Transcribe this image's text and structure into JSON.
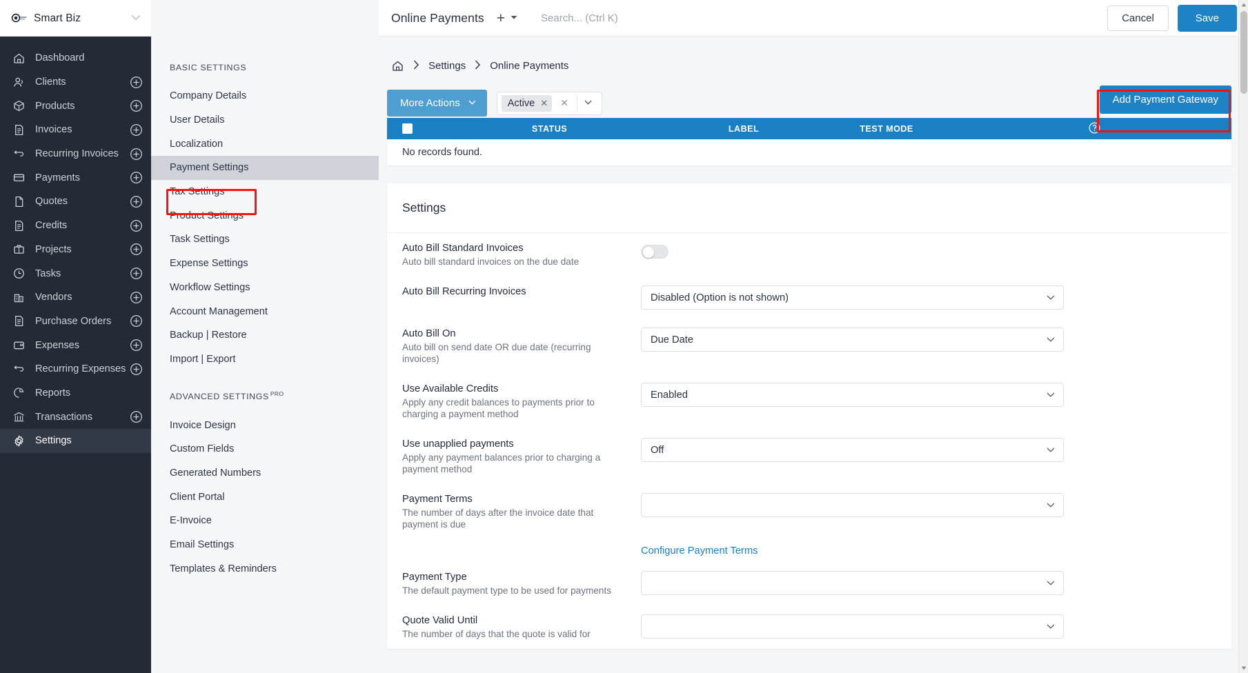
{
  "brand": {
    "name": "Smart Biz",
    "subtitle_redacted": true,
    "logo_icon": "invoiceninja-logo-icon",
    "caret_icon": "chevron-down-icon"
  },
  "sidebar": {
    "items": [
      {
        "label": "Dashboard",
        "icon": "home-icon",
        "plus": false,
        "active": false
      },
      {
        "label": "Clients",
        "icon": "users-icon",
        "plus": true,
        "active": false
      },
      {
        "label": "Products",
        "icon": "cube-icon",
        "plus": true,
        "active": false
      },
      {
        "label": "Invoices",
        "icon": "file-text-icon",
        "plus": true,
        "active": false
      },
      {
        "label": "Recurring Invoices",
        "icon": "refresh-icon",
        "plus": true,
        "active": false
      },
      {
        "label": "Payments",
        "icon": "credit-card-icon",
        "plus": true,
        "active": false
      },
      {
        "label": "Quotes",
        "icon": "file-icon",
        "plus": true,
        "active": false
      },
      {
        "label": "Credits",
        "icon": "file-text-icon",
        "plus": true,
        "active": false
      },
      {
        "label": "Projects",
        "icon": "briefcase-icon",
        "plus": true,
        "active": false
      },
      {
        "label": "Tasks",
        "icon": "clock-icon",
        "plus": true,
        "active": false
      },
      {
        "label": "Vendors",
        "icon": "building-icon",
        "plus": true,
        "active": false
      },
      {
        "label": "Purchase Orders",
        "icon": "file-text-icon",
        "plus": true,
        "active": false
      },
      {
        "label": "Expenses",
        "icon": "wallet-icon",
        "plus": true,
        "active": false
      },
      {
        "label": "Recurring Expenses",
        "icon": "refresh-icon",
        "plus": true,
        "active": false
      },
      {
        "label": "Reports",
        "icon": "pie-chart-icon",
        "plus": false,
        "active": false
      },
      {
        "label": "Transactions",
        "icon": "bank-icon",
        "plus": true,
        "active": false
      },
      {
        "label": "Settings",
        "icon": "gear-icon",
        "plus": false,
        "active": true
      }
    ]
  },
  "settings_nav": {
    "basic_title": "BASIC SETTINGS",
    "advanced_title": "ADVANCED SETTINGS",
    "advanced_badge": "PRO",
    "basic_items": [
      {
        "label": "Company Details",
        "selected": false
      },
      {
        "label": "User Details",
        "selected": false
      },
      {
        "label": "Localization",
        "selected": false
      },
      {
        "label": "Payment Settings",
        "selected": true
      },
      {
        "label": "Tax Settings",
        "selected": false
      },
      {
        "label": "Product Settings",
        "selected": false
      },
      {
        "label": "Task Settings",
        "selected": false
      },
      {
        "label": "Expense Settings",
        "selected": false
      },
      {
        "label": "Workflow Settings",
        "selected": false
      },
      {
        "label": "Account Management",
        "selected": false
      },
      {
        "label": "Backup | Restore",
        "selected": false
      },
      {
        "label": "Import | Export",
        "selected": false
      }
    ],
    "advanced_items": [
      {
        "label": "Invoice Design",
        "selected": false
      },
      {
        "label": "Custom Fields",
        "selected": false
      },
      {
        "label": "Generated Numbers",
        "selected": false
      },
      {
        "label": "Client Portal",
        "selected": false
      },
      {
        "label": "E-Invoice",
        "selected": false
      },
      {
        "label": "Email Settings",
        "selected": false
      },
      {
        "label": "Templates & Reminders",
        "selected": false
      }
    ]
  },
  "topbar": {
    "title": "Online Payments",
    "plus_label": "+",
    "plus_caret_icon": "caret-down-icon",
    "search_placeholder": "Search... (Ctrl K)",
    "search_value": "",
    "cancel_label": "Cancel",
    "save_label": "Save"
  },
  "breadcrumb": {
    "home_icon": "home-icon",
    "separator": "›",
    "items": [
      "Settings",
      "Online Payments"
    ]
  },
  "toolbar": {
    "more_actions_label": "More Actions",
    "more_actions_caret": "chevron-down-icon",
    "filter_chip": "Active",
    "filter_chip_remove_icon": "close-icon",
    "filter_clear_icon": "close-icon",
    "filter_caret_icon": "chevron-down-icon",
    "add_gateway_label": "Add Payment Gateway"
  },
  "table": {
    "columns": [
      "STATUS",
      "LABEL",
      "TEST MODE"
    ],
    "help_icon": "help-circle-icon",
    "select_all_checkbox": true,
    "empty_message": "No records found.",
    "rows": []
  },
  "settings_panel": {
    "title": "Settings",
    "rows": [
      {
        "label": "Auto Bill Standard Invoices",
        "description": "Auto bill standard invoices on the due date",
        "control": "toggle",
        "value": "off"
      },
      {
        "label": "Auto Bill Recurring Invoices",
        "description": "",
        "control": "select",
        "value": "Disabled (Option is not shown)"
      },
      {
        "label": "Auto Bill On",
        "description": "Auto bill on send date OR due date (recurring invoices)",
        "control": "select",
        "value": "Due Date"
      },
      {
        "label": "Use Available Credits",
        "description": "Apply any credit balances to payments prior to charging a payment method",
        "control": "select",
        "value": "Enabled"
      },
      {
        "label": "Use unapplied payments",
        "description": "Apply any payment balances prior to charging a payment method",
        "control": "select",
        "value": "Off"
      },
      {
        "label": "Payment Terms",
        "description": "The number of days after the invoice date that payment is due",
        "control": "select",
        "value": ""
      }
    ],
    "configure_link": "Configure Payment Terms",
    "rows2": [
      {
        "label": "Payment Type",
        "description": "The default payment type to be used for payments",
        "control": "select",
        "value": ""
      },
      {
        "label": "Quote Valid Until",
        "description": "The number of days that the quote is valid for",
        "control": "select",
        "value": ""
      }
    ]
  },
  "annotations": {
    "highlight_color": "#f4140c",
    "boxes": [
      "payment-settings-nav-item",
      "add-payment-gateway-button"
    ]
  },
  "colors": {
    "sidebar_bg": "#242b36",
    "accent_blue": "#1d83c6",
    "table_header_blue": "#1a80c4",
    "more_actions_blue": "#4f9ed1",
    "page_bg": "#f5f6f7",
    "selected_nav": "#cfd3d9"
  },
  "scrollbar": {
    "up_icon": "triangle-up-icon",
    "down_icon": "triangle-down-icon"
  }
}
